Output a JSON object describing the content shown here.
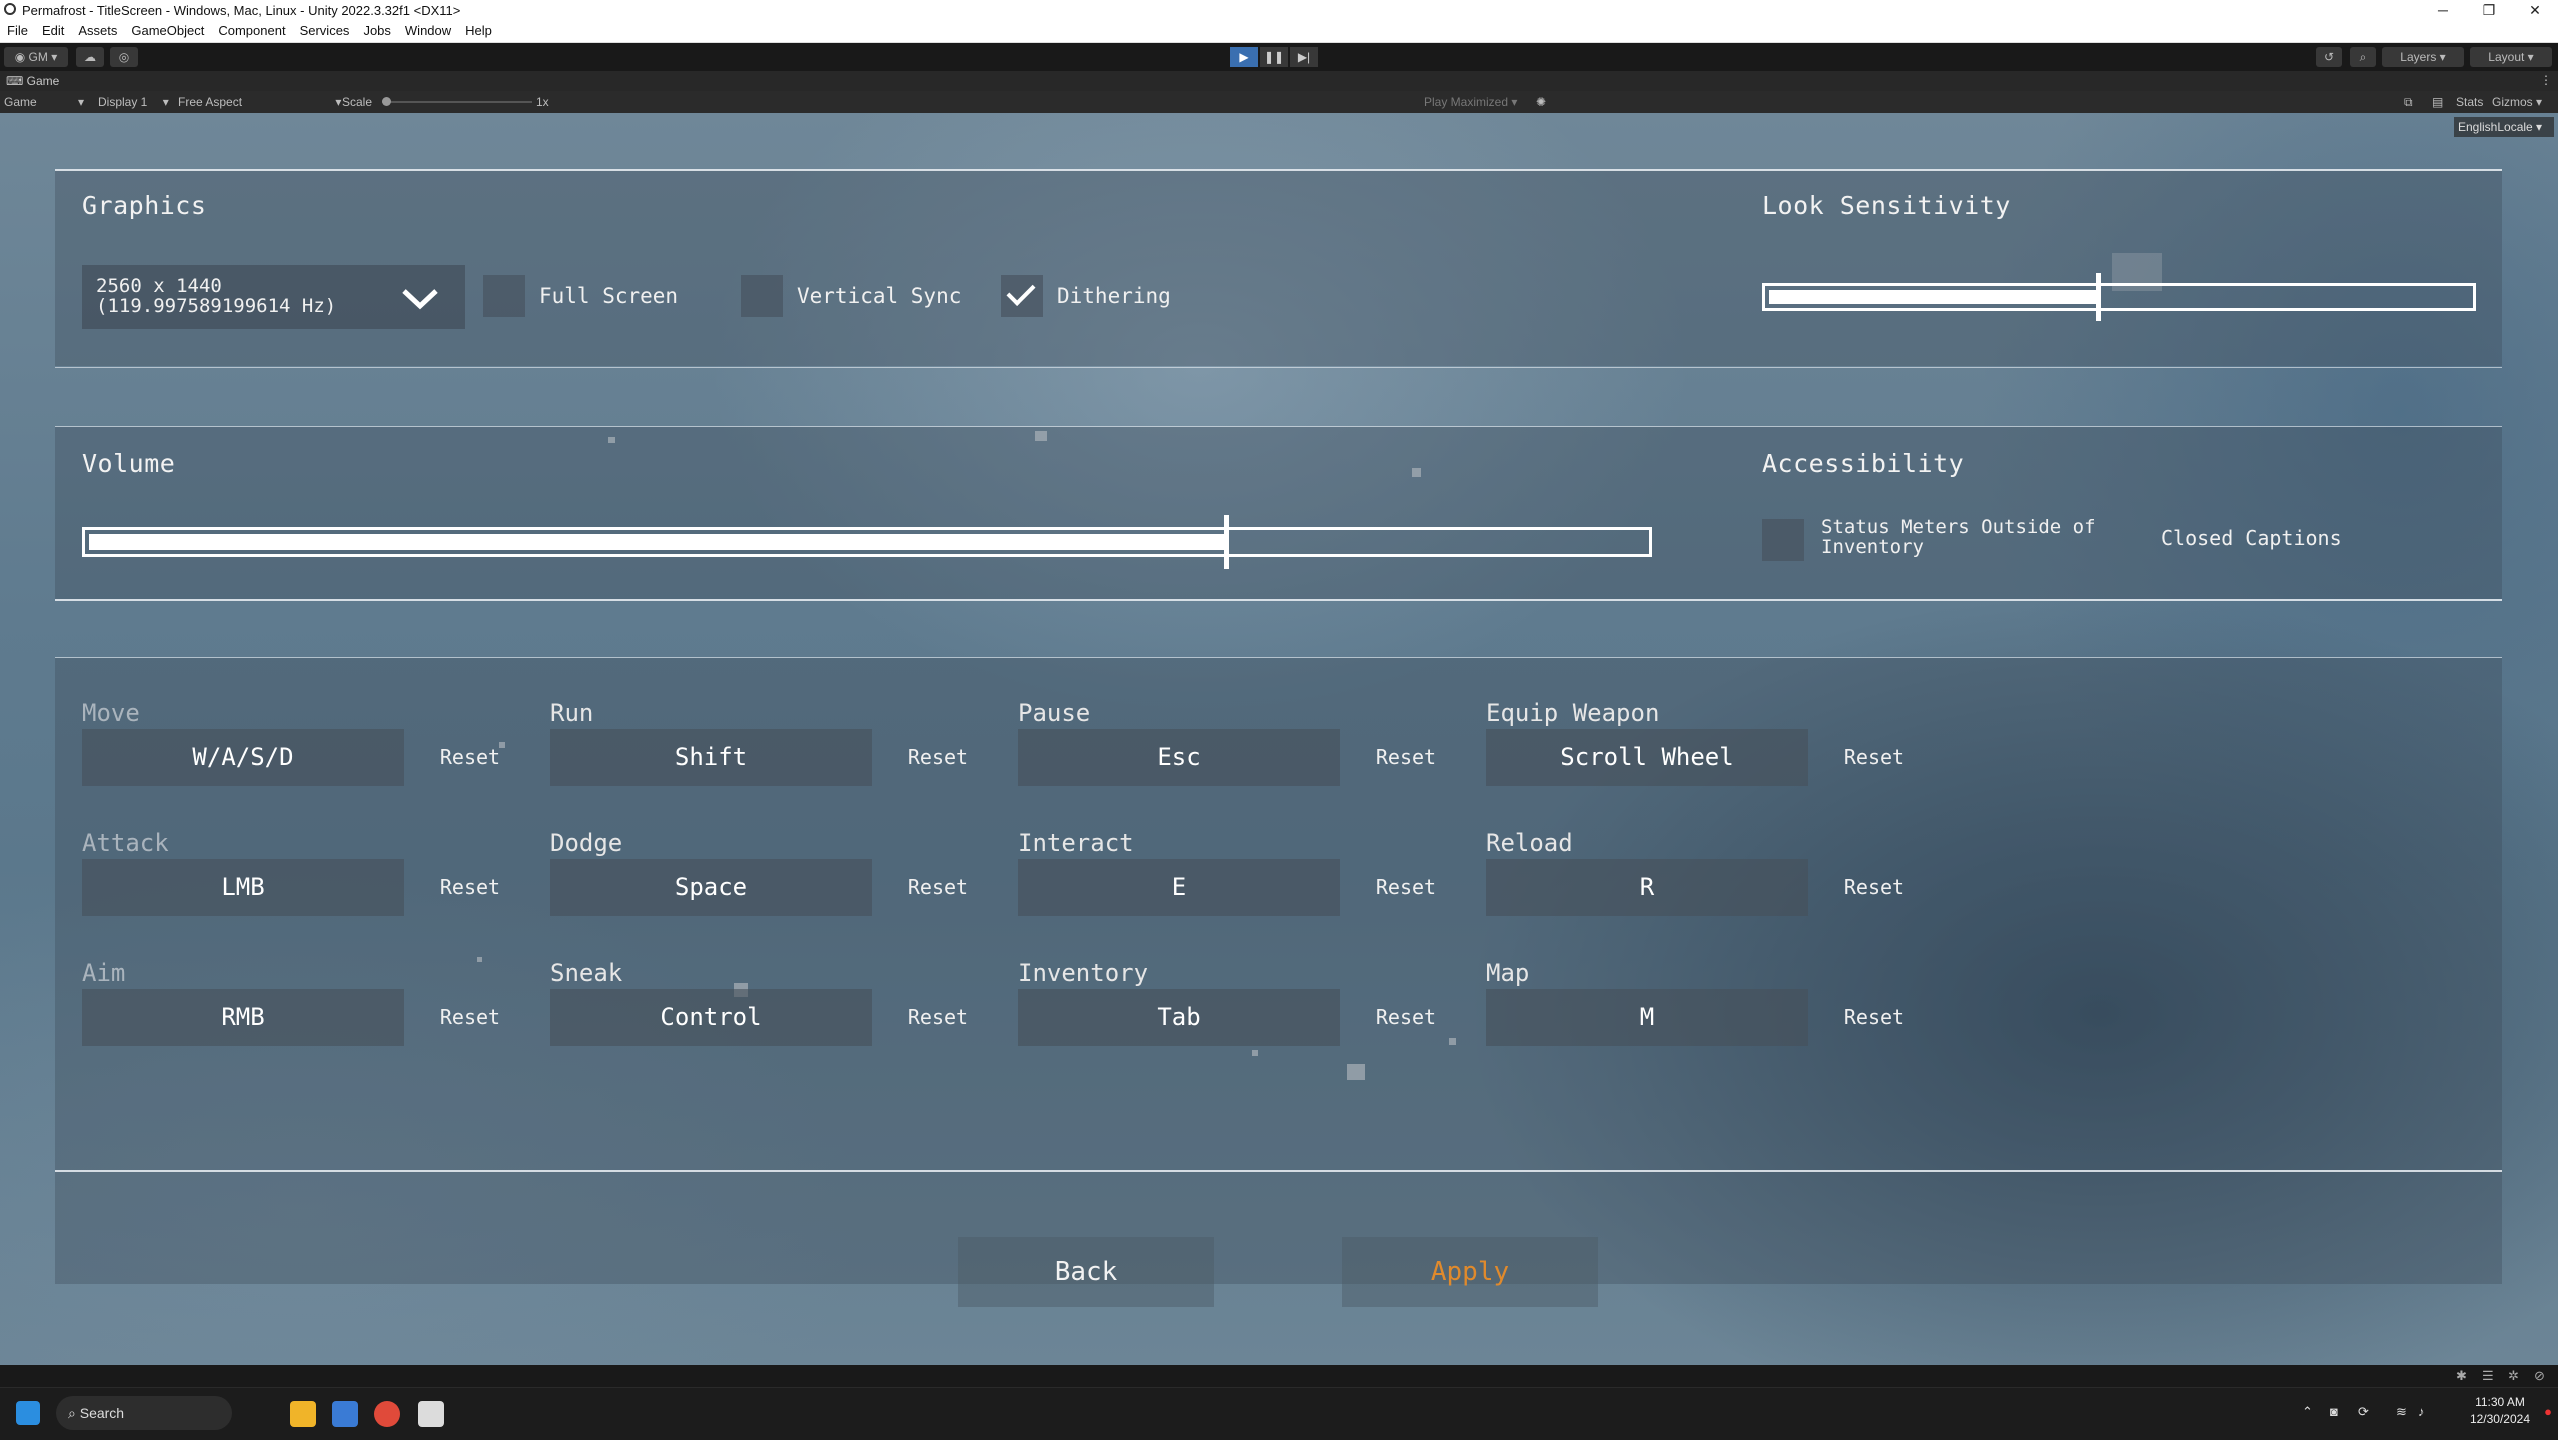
{
  "window": {
    "title": "Permafrost - TitleScreen - Windows, Mac, Linux - Unity 2022.3.32f1 <DX11>",
    "controls": [
      "─",
      "❐",
      "✕"
    ]
  },
  "menu": [
    "File",
    "Edit",
    "Assets",
    "GameObject",
    "Component",
    "Services",
    "Jobs",
    "Window",
    "Help"
  ],
  "toolbar": {
    "account": "GM",
    "layers": "Layers",
    "layout": "Layout"
  },
  "game_tab": {
    "label": "Game"
  },
  "game_bar": {
    "mode": "Game",
    "display": "Display 1",
    "aspect": "Free Aspect",
    "scale_label": "Scale",
    "scale_value": "1x",
    "play_maximized": "Play Maximized",
    "stats": "Stats",
    "gizmos": "Gizmos",
    "locale": "EnglishLocale"
  },
  "graphics": {
    "title": "Graphics",
    "resolution_line1": "2560 x 1440",
    "resolution_line2": "(119.997589199614 Hz)",
    "fullscreen_label": "Full Screen",
    "fullscreen_checked": false,
    "vsync_label": "Vertical Sync",
    "vsync_checked": false,
    "dithering_label": "Dithering",
    "dithering_checked": true
  },
  "look_sensitivity": {
    "title": "Look Sensitivity",
    "value": 0.47
  },
  "volume": {
    "title": "Volume",
    "value": 0.73
  },
  "accessibility": {
    "title": "Accessibility",
    "status_meters_line1": "Status Meters Outside of",
    "status_meters_line2": "Inventory",
    "status_meters_checked": false,
    "closed_captions_label": "Closed Captions",
    "closed_captions_checked": false
  },
  "bindings": [
    {
      "action": "Move",
      "key": "W/A/S/D",
      "reset": "Reset",
      "dim": true
    },
    {
      "action": "Run",
      "key": "Shift",
      "reset": "Reset",
      "dim": false
    },
    {
      "action": "Pause",
      "key": "Esc",
      "reset": "Reset",
      "dim": false
    },
    {
      "action": "Equip Weapon",
      "key": "Scroll Wheel",
      "reset": "Reset",
      "dim": false
    },
    {
      "action": "Attack",
      "key": "LMB",
      "reset": "Reset",
      "dim": true
    },
    {
      "action": "Dodge",
      "key": "Space",
      "reset": "Reset",
      "dim": false
    },
    {
      "action": "Interact",
      "key": "E",
      "reset": "Reset",
      "dim": false
    },
    {
      "action": "Reload",
      "key": "R",
      "reset": "Reset",
      "dim": false
    },
    {
      "action": "Aim",
      "key": "RMB",
      "reset": "Reset",
      "dim": true
    },
    {
      "action": "Sneak",
      "key": "Control",
      "reset": "Reset",
      "dim": false
    },
    {
      "action": "Inventory",
      "key": "Tab",
      "reset": "Reset",
      "dim": false
    },
    {
      "action": "Map",
      "key": "M",
      "reset": "Reset",
      "dim": false
    }
  ],
  "footer": {
    "back": "Back",
    "apply": "Apply"
  },
  "colors": {
    "apply": "#e08a2c",
    "accent_play": "#3a6fb0",
    "text": "#f2f2f2"
  },
  "taskbar": {
    "search": "Search",
    "time": "11:30 AM",
    "date": "12/30/2024"
  }
}
